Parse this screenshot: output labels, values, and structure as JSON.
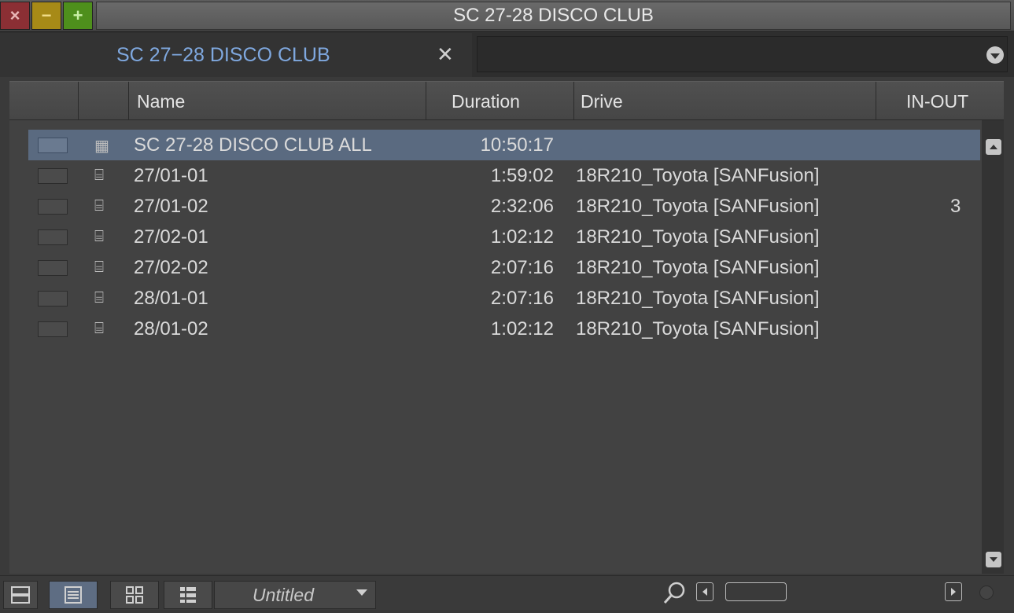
{
  "window": {
    "title": "SC 27-28 DISCO CLUB",
    "close_icon": "×",
    "minimize_icon": "−",
    "zoom_icon": "+"
  },
  "tab": {
    "label": "SC 27−28 DISCO CLUB",
    "close_icon": "✕"
  },
  "columns": {
    "name": "Name",
    "duration": "Duration",
    "drive": "Drive",
    "in_out": "IN-OUT"
  },
  "rows": [
    {
      "icon": "sequence-icon",
      "glyph": "▦",
      "name": "SC 27-28 DISCO CLUB ALL",
      "duration": "10:50:17",
      "drive": "",
      "in_out": "",
      "selected": true
    },
    {
      "icon": "clip-icon",
      "glyph": "⌸",
      "name": "27/01-01",
      "duration": "1:59:02",
      "drive": "18R210_Toyota [SANFusion]",
      "in_out": ""
    },
    {
      "icon": "clip-icon",
      "glyph": "⌸",
      "name": "27/01-02",
      "duration": "2:32:06",
      "drive": "18R210_Toyota [SANFusion]",
      "in_out": "3"
    },
    {
      "icon": "clip-icon",
      "glyph": "⌸",
      "name": "27/02-01",
      "duration": "1:02:12",
      "drive": "18R210_Toyota [SANFusion]",
      "in_out": ""
    },
    {
      "icon": "clip-icon",
      "glyph": "⌸",
      "name": "27/02-02",
      "duration": "2:07:16",
      "drive": "18R210_Toyota [SANFusion]",
      "in_out": ""
    },
    {
      "icon": "clip-icon",
      "glyph": "⌸",
      "name": "28/01-01",
      "duration": "2:07:16",
      "drive": "18R210_Toyota [SANFusion]",
      "in_out": ""
    },
    {
      "icon": "clip-icon",
      "glyph": "⌸",
      "name": "28/01-02",
      "duration": "1:02:12",
      "drive": "18R210_Toyota [SANFusion]",
      "in_out": ""
    }
  ],
  "footer": {
    "view_menu_label": "Untitled",
    "view_buttons": [
      "frame-view-icon",
      "list-view-icon",
      "thumbnail-view-icon",
      "script-view-icon"
    ]
  },
  "colors": {
    "tab_label": "#7fa8df",
    "selection": "#5a6a80",
    "close": "#8b2f34",
    "minimize": "#a78a17",
    "zoom": "#4e8f1c"
  }
}
